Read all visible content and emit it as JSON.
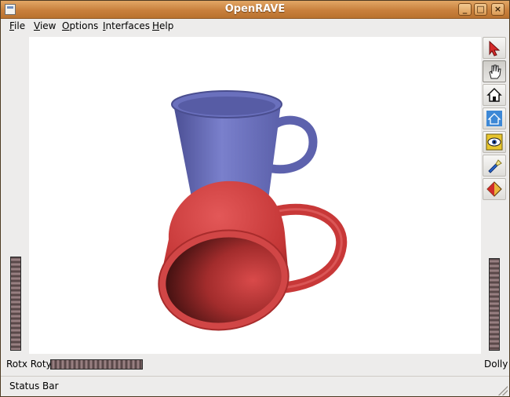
{
  "window": {
    "title": "OpenRAVE",
    "minimize_glyph": "_",
    "maximize_glyph": "□",
    "close_glyph": "×"
  },
  "menu": [
    {
      "key": "F",
      "rest": "ile"
    },
    {
      "key": "V",
      "rest": "iew"
    },
    {
      "key": "O",
      "rest": "ptions"
    },
    {
      "key": "I",
      "rest": "nterfaces"
    },
    {
      "key": "H",
      "rest": "elp"
    }
  ],
  "toolbar_icons": [
    "select-arrow-icon",
    "hand-pan-icon",
    "home-view-icon",
    "set-home-icon",
    "view-all-eye-icon",
    "headlight-flashlight-icon",
    "draw-style-cube-icon"
  ],
  "colors": {
    "blue_mug": "#6e74c0",
    "red_mug": "#cc3b3b",
    "title_bar": "#c9803d"
  },
  "controls": {
    "rotx_roty_label": "Rotx Roty",
    "dolly_label": "Dolly"
  },
  "status": {
    "text": "Status Bar"
  }
}
